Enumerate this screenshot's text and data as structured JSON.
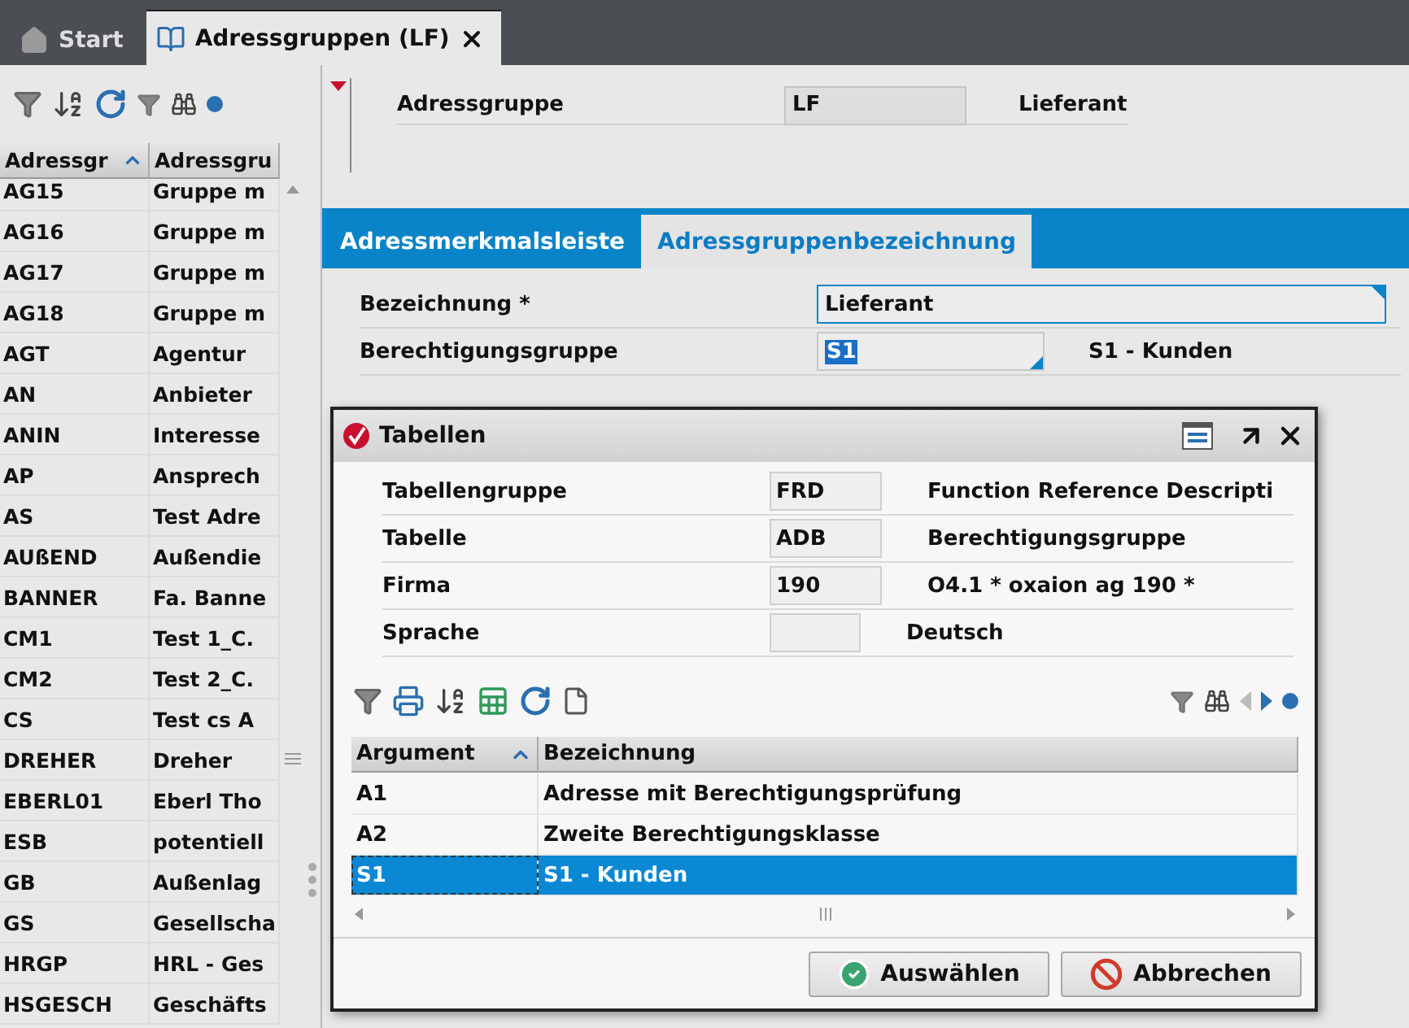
{
  "tabs": [
    {
      "label": "Start",
      "kind": "home",
      "selected": false,
      "closable": false
    },
    {
      "label": "Adressgruppen (LF)",
      "kind": "document",
      "selected": true,
      "closable": true
    }
  ],
  "left_table": {
    "columns": [
      {
        "label": "Adressgr",
        "sorted": true
      },
      {
        "label": "Adressgru",
        "sorted": false
      }
    ],
    "rows": [
      [
        "AG15",
        "Gruppe m"
      ],
      [
        "AG16",
        "Gruppe m"
      ],
      [
        "AG17",
        "Gruppe m"
      ],
      [
        "AG18",
        "Gruppe m"
      ],
      [
        "AGT",
        "Agentur"
      ],
      [
        "AN",
        "Anbieter"
      ],
      [
        "ANIN",
        "Interesse"
      ],
      [
        "AP",
        "Ansprech"
      ],
      [
        "AS",
        "Test Adre"
      ],
      [
        "AUßEND",
        "Außendie"
      ],
      [
        "BANNER",
        "Fa. Banne"
      ],
      [
        "CM1",
        "Test 1_C."
      ],
      [
        "CM2",
        "Test 2_C."
      ],
      [
        "CS",
        "Test cs A"
      ],
      [
        "DREHER",
        "Dreher"
      ],
      [
        "EBERL01",
        "Eberl Tho"
      ],
      [
        "ESB",
        "potentiell"
      ],
      [
        "GB",
        "Außenlag"
      ],
      [
        "GS",
        "Gesellscha"
      ],
      [
        "HRGP",
        "HRL - Ges"
      ],
      [
        "HSGESCH",
        "Geschäfts"
      ]
    ]
  },
  "header": {
    "label": "Adressgruppe",
    "value": "LF",
    "description": "Lieferant"
  },
  "detail_tabs": [
    {
      "label": "Adressmerkmalsleiste",
      "selected": false
    },
    {
      "label": "Adressgruppenbezeichnung",
      "selected": true
    }
  ],
  "detail_fields": [
    {
      "label": "Bezeichnung *",
      "kind": "text",
      "value": "Lieferant"
    },
    {
      "label": "Berechtigungsgruppe",
      "kind": "lookup",
      "value": "S1",
      "value_selected": true,
      "description": "S1 - Kunden"
    }
  ],
  "dialog": {
    "title": "Tabellen",
    "fields": [
      {
        "label": "Tabellengruppe",
        "value": "FRD",
        "description": "Function Reference Descripti"
      },
      {
        "label": "Tabelle",
        "value": "ADB",
        "description": "Berechtigungsgruppe"
      },
      {
        "label": "Firma",
        "value": "190",
        "description": "O4.1 * oxaion ag 190   *"
      },
      {
        "label": "Sprache",
        "description": "Deutsch"
      }
    ],
    "table": {
      "columns": [
        {
          "label": "Argument",
          "sorted": true
        },
        {
          "label": "Bezeichnung",
          "sorted": false
        }
      ],
      "rows": [
        {
          "cells": [
            "A1",
            "Adresse mit Berechtigungsprüfung"
          ],
          "selected": false
        },
        {
          "cells": [
            "A2",
            "Zweite Berechtigungsklasse"
          ],
          "selected": false
        },
        {
          "cells": [
            "S1",
            "S1 - Kunden"
          ],
          "selected": true
        }
      ]
    },
    "buttons": [
      {
        "label": "Auswählen",
        "kind": "confirm"
      },
      {
        "label": "Abbrechen",
        "kind": "cancel"
      }
    ]
  }
}
